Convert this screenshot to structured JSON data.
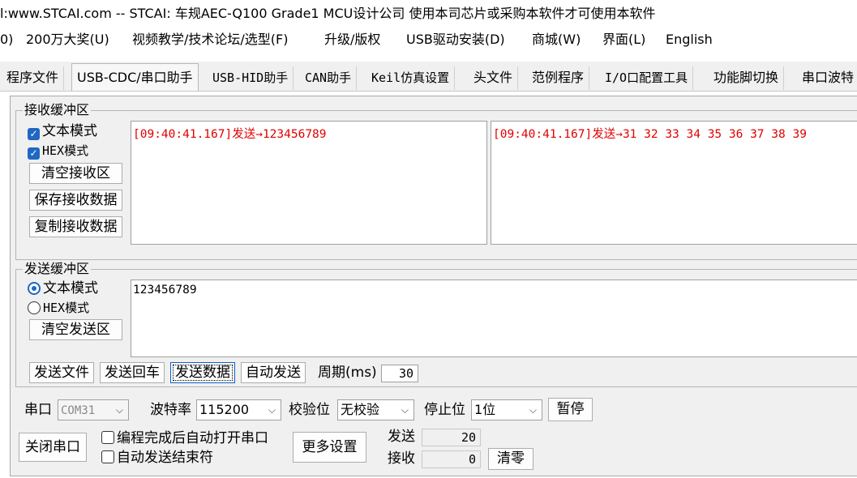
{
  "window": {
    "title": "l:www.STCAI.com  -- STCAI: 车规AEC-Q100 Grade1 MCU设计公司 使用本司芯片或采购本软件才可使用本软件"
  },
  "menu": [
    "0)",
    "200万大奖(U)",
    "视频教学/技术论坛/选型(F)",
    "升级/版权",
    "USB驱动安装(D)",
    "商城(W)",
    "界面(L)",
    "English"
  ],
  "tabs": [
    {
      "label": "程序文件"
    },
    {
      "label": "USB-CDC/串口助手",
      "active": true
    },
    {
      "label": "USB-HID助手"
    },
    {
      "label": "CAN助手"
    },
    {
      "label": "Keil仿真设置"
    },
    {
      "label": "头文件"
    },
    {
      "label": "范例程序"
    },
    {
      "label": "I/O口配置工具"
    },
    {
      "label": "功能脚切换"
    },
    {
      "label": "串口波特"
    }
  ],
  "receive": {
    "title": "接收缓冲区",
    "text_mode_label": "文本模式",
    "text_mode_checked": true,
    "hex_mode_label": "HEX模式",
    "hex_mode_checked": true,
    "clear_label": "清空接收区",
    "save_label": "保存接收数据",
    "copy_label": "复制接收数据",
    "text_content": "[09:40:41.167]发送→123456789",
    "hex_content": "[09:40:41.167]发送→31 32 33 34 35 36 37 38 39"
  },
  "send": {
    "title": "发送缓冲区",
    "text_mode_label": "文本模式",
    "hex_mode_label": "HEX模式",
    "selected_mode": "text",
    "clear_label": "清空发送区",
    "content": "123456789",
    "send_file_label": "发送文件",
    "send_enter_label": "发送回车",
    "send_data_label": "发送数据",
    "auto_send_label": "自动发送",
    "period_label": "周期(ms)",
    "period_value": "30"
  },
  "settings": {
    "port_label": "串口",
    "port_value": "COM31",
    "baud_label": "波特率",
    "baud_value": "115200",
    "parity_label": "校验位",
    "parity_value": "无校验",
    "stopbit_label": "停止位",
    "stopbit_value": "1位",
    "pause_label": "暂停",
    "close_port_label": "关闭串口",
    "auto_open_label": "编程完成后自动打开串口",
    "auto_send_end_label": "自动发送结束符",
    "more_settings_label": "更多设置",
    "sent_label": "发送",
    "sent_count": "20",
    "recv_label": "接收",
    "recv_count": "0",
    "reset_label": "清零"
  },
  "colors": {
    "accent": "#2067c4",
    "log_red": "#e00000",
    "panel_bg": "#f0f0f0"
  }
}
